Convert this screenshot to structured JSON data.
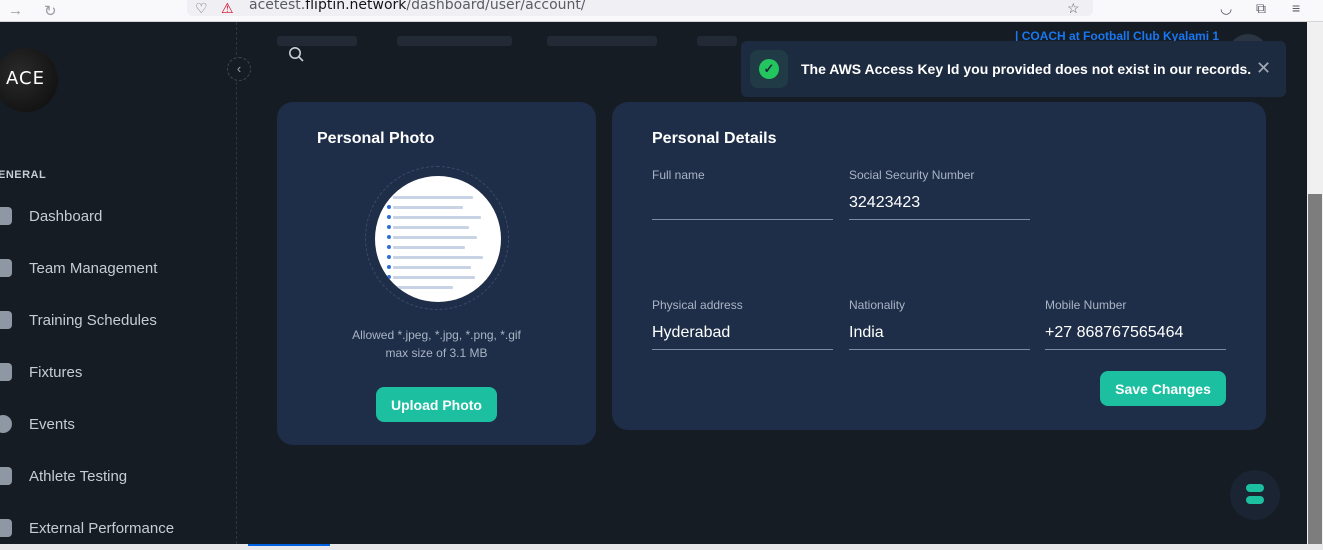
{
  "browser": {
    "url_prefix": "acetest.",
    "url_domain": "fliptin.network",
    "url_path": "/dashboard/user/account/"
  },
  "sidebar": {
    "logo_text": "ACE",
    "section_label": "ENERAL",
    "items": [
      {
        "label": "Dashboard",
        "icon": "dashboard-icon"
      },
      {
        "label": "Team Management",
        "icon": "team-icon"
      },
      {
        "label": "Training Schedules",
        "icon": "calendar-icon"
      },
      {
        "label": "Fixtures",
        "icon": "fixtures-icon"
      },
      {
        "label": "Events",
        "icon": "events-icon"
      },
      {
        "label": "Athlete Testing",
        "icon": "athlete-icon"
      },
      {
        "label": "External Performance",
        "icon": "performance-icon"
      }
    ]
  },
  "header": {
    "coach_label": "| COACH at Football Club Kyalami 1"
  },
  "toast": {
    "message": "The AWS Access Key Id you provided does not exist in our records.",
    "close": "✕"
  },
  "photo_card": {
    "title": "Personal Photo",
    "allowed_line1": "Allowed *.jpeg, *.jpg, *.png, *.gif",
    "allowed_line2": "max size of 3.1 MB",
    "upload_label": "Upload Photo"
  },
  "details_card": {
    "title": "Personal Details",
    "fields": {
      "full_name": {
        "label": "Full name",
        "value": ""
      },
      "ssn": {
        "label": "Social Security Number",
        "value": "32423423"
      },
      "address": {
        "label": "Physical address",
        "value": "Hyderabad"
      },
      "nationality": {
        "label": "Nationality",
        "value": "India"
      },
      "mobile": {
        "label": "Mobile Number",
        "value": "+27 868767565464"
      }
    },
    "save_label": "Save Changes"
  },
  "colors": {
    "accent": "#1cbfa0",
    "card": "#1e2d48",
    "background": "#161c24",
    "coach_link": "#1877f2",
    "success": "#22c55e"
  }
}
